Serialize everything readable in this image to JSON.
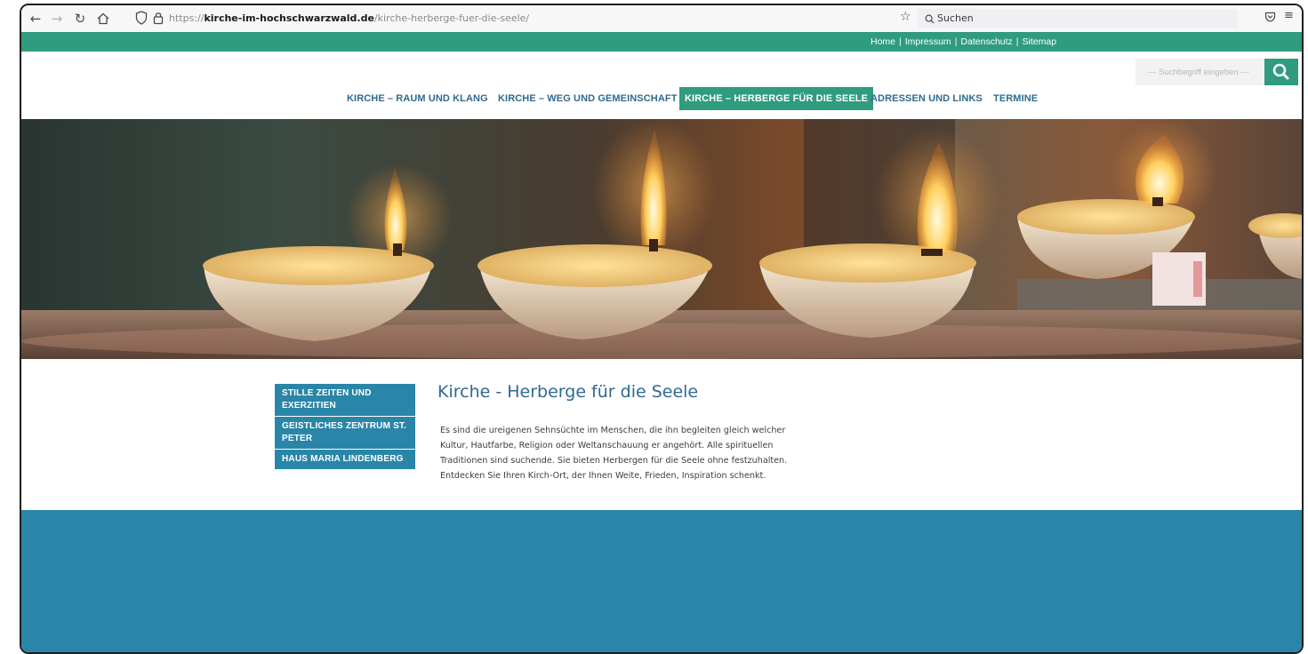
{
  "browser": {
    "url_prefix": "https://",
    "url_domain": "kirche-im-hochschwarzwald.de",
    "url_path": "/kirche-herberge-fuer-die-seele/",
    "search_placeholder": "Suchen"
  },
  "topbar": {
    "links": [
      "Home",
      "Impressum",
      "Datenschutz",
      "Sitemap"
    ],
    "separator": "|"
  },
  "header": {
    "search_placeholder": "--- Suchbegriff eingeben ---"
  },
  "nav": {
    "items": [
      {
        "label": "KIRCHE – RAUM UND KLANG"
      },
      {
        "label": "KIRCHE – WEG UND GEMEINSCHAFT"
      },
      {
        "label": "KIRCHE – HERBERGE FÜR DIE SEELE"
      },
      {
        "label": "ADRESSEN UND LINKS"
      },
      {
        "label": "TERMINE"
      }
    ],
    "active_index": 2
  },
  "sidebar": {
    "items": [
      {
        "label": "STILLE ZEITEN UND EXERZITIEN"
      },
      {
        "label": "GEISTLICHES ZENTRUM ST. PETER"
      },
      {
        "label": "HAUS MARIA LINDENBERG"
      }
    ]
  },
  "main": {
    "title": "Kirche - Herberge für die Seele",
    "paragraph_lines": [
      "Es sind die ureigenen Sehnsüchte im Menschen, die ihn begleiten gleich welcher",
      "Kultur, Hautfarbe, Religion oder Weltanschauung er angehört. Alle spirituellen",
      "Traditionen sind suchende. Sie bieten Herbergen für die Seele ohne festzuhalten.",
      "Entdecken Sie Ihren Kirch-Ort, der Ihnen Weite, Frieden, Inspiration schenkt."
    ]
  },
  "colors": {
    "green": "#2f9c7f",
    "blue": "#2a86a8",
    "nav_text": "#2f6a8f"
  },
  "icons": [
    "back-icon",
    "forward-icon",
    "reload-icon",
    "home-icon",
    "shield-icon",
    "lock-icon",
    "bookmark-star-icon",
    "search-icon",
    "pocket-icon",
    "menu-icon"
  ]
}
